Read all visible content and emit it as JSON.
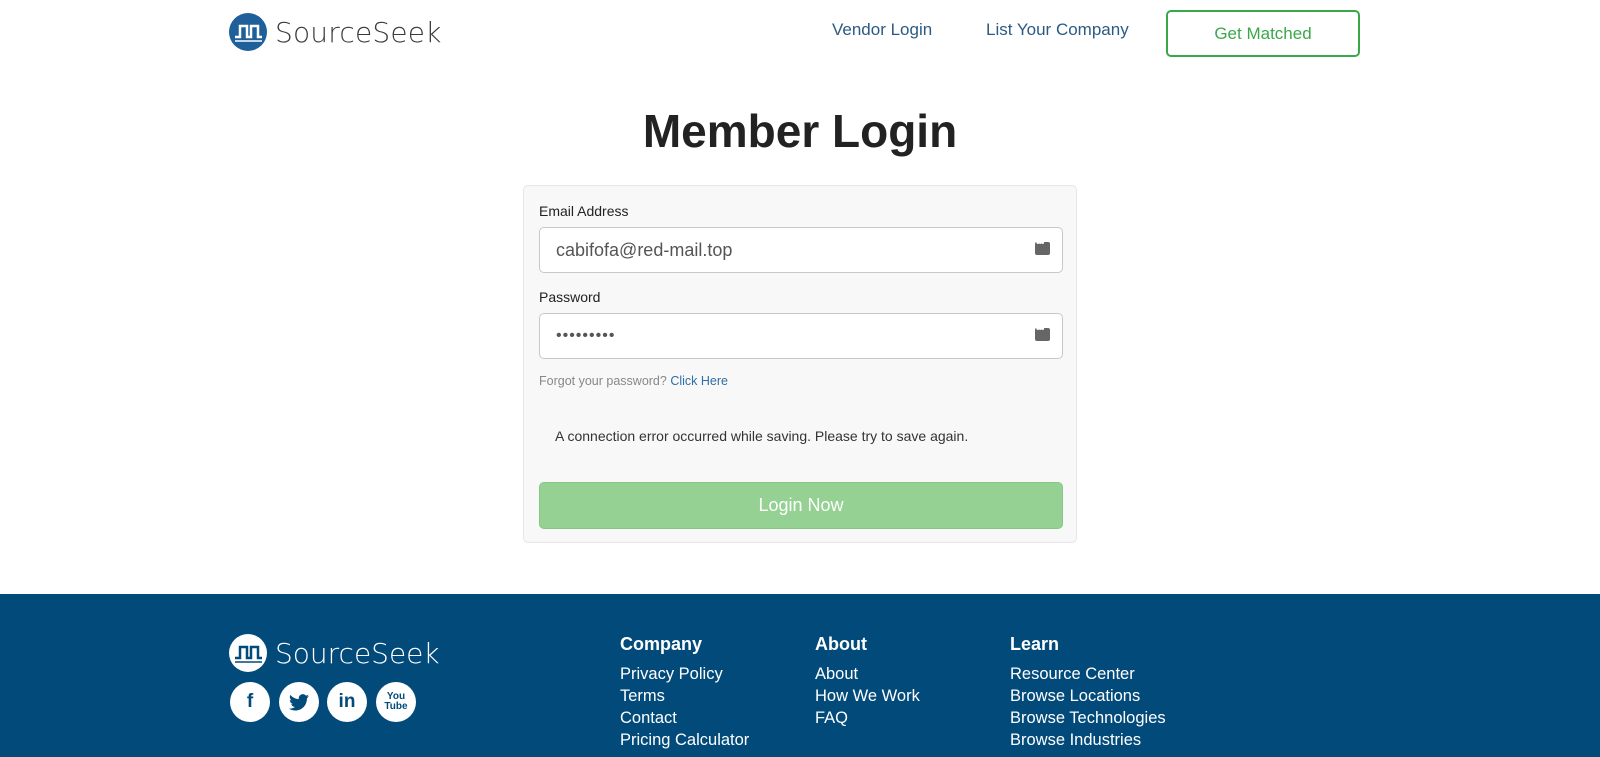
{
  "header": {
    "logo_text": "SourceSeek",
    "nav": {
      "vendor_login": "Vendor Login",
      "list_company": "List Your Company",
      "get_matched": "Get Matched"
    }
  },
  "main": {
    "title": "Member Login",
    "form": {
      "email_label": "Email Address",
      "email_value": "cabifofa@red-mail.top",
      "password_label": "Password",
      "password_value": "•••••••••",
      "forgot_text": "Forgot your password?",
      "forgot_link": "Click Here",
      "error_message": "A connection error occurred while saving. Please try to save again.",
      "submit_label": "Login Now"
    }
  },
  "footer": {
    "logo_text": "SourceSeek",
    "social": {
      "facebook": "f",
      "twitter": "t",
      "linkedin": "in",
      "youtube": "You Tube"
    },
    "columns": {
      "company": {
        "heading": "Company",
        "links": [
          "Privacy Policy",
          "Terms",
          "Contact",
          "Pricing Calculator"
        ]
      },
      "about": {
        "heading": "About",
        "links": [
          "About",
          "How We Work",
          "FAQ"
        ]
      },
      "learn": {
        "heading": "Learn",
        "links": [
          "Resource Center",
          "Browse Locations",
          "Browse Technologies",
          "Browse Industries"
        ]
      }
    }
  },
  "colors": {
    "brand_blue": "#024a7a",
    "accent_green": "#3aa84a",
    "button_green_disabled": "#95d193",
    "link_blue": "#2d6ea6"
  },
  "icons": [
    "sourceseek-logo-icon",
    "autofill-key-icon",
    "facebook-icon",
    "twitter-icon",
    "linkedin-icon",
    "youtube-icon"
  ]
}
